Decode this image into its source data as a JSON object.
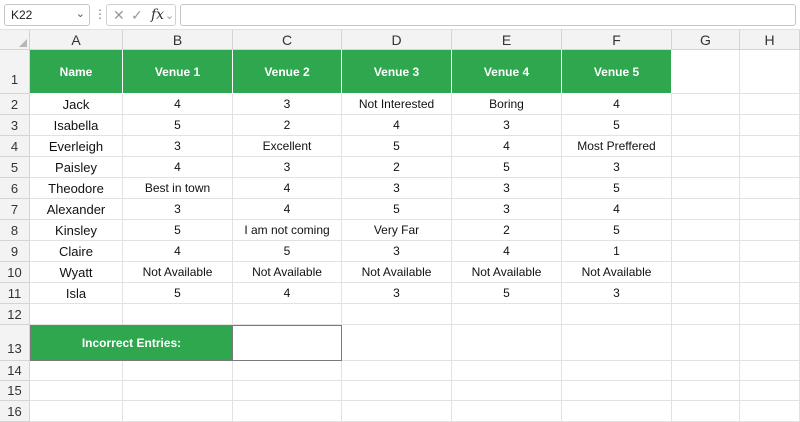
{
  "formula_bar": {
    "name_box": "K22",
    "formula": ""
  },
  "columns": [
    "A",
    "B",
    "C",
    "D",
    "E",
    "F",
    "G",
    "H"
  ],
  "rows": [
    "1",
    "2",
    "3",
    "4",
    "5",
    "6",
    "7",
    "8",
    "9",
    "10",
    "11",
    "12",
    "13",
    "14",
    "15",
    "16"
  ],
  "table": {
    "headers": [
      "Name",
      "Venue 1",
      "Venue 2",
      "Venue 3",
      "Venue 4",
      "Venue 5"
    ],
    "body": [
      [
        "Jack",
        "4",
        "3",
        "Not Interested",
        "Boring",
        "4"
      ],
      [
        "Isabella",
        "5",
        "2",
        "4",
        "3",
        "5"
      ],
      [
        "Everleigh",
        "3",
        "Excellent",
        "5",
        "4",
        "Most Preffered"
      ],
      [
        "Paisley",
        "4",
        "3",
        "2",
        "5",
        "3"
      ],
      [
        "Theodore",
        "Best in town",
        "4",
        "3",
        "3",
        "5"
      ],
      [
        "Alexander",
        "3",
        "4",
        "5",
        "3",
        "4"
      ],
      [
        "Kinsley",
        "5",
        "I am not coming",
        "Very Far",
        "2",
        "5"
      ],
      [
        "Claire",
        "4",
        "5",
        "3",
        "4",
        "1"
      ],
      [
        "Wyatt",
        "Not Available",
        "Not Available",
        "Not Available",
        "Not Available",
        "Not Available"
      ],
      [
        "Isla",
        "5",
        "4",
        "3",
        "5",
        "3"
      ]
    ]
  },
  "summary": {
    "label": "Incorrect Entries:",
    "value": ""
  },
  "colors": {
    "header_green": "#2ea74e",
    "header_text": "#ffffff"
  }
}
